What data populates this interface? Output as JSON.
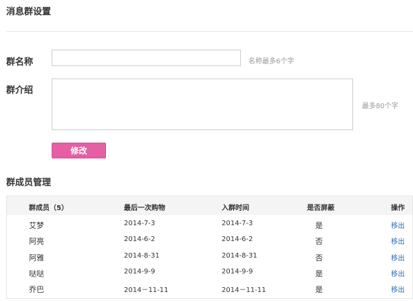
{
  "page_title": "消息群设置",
  "form": {
    "name_label": "群名称",
    "name_value": "",
    "name_hint": "名称最多6个字",
    "intro_label": "群介绍",
    "intro_value": "",
    "intro_hint": "最多80个字",
    "submit_label": "修改"
  },
  "members": {
    "section_title": "群成员管理",
    "columns": [
      "群成员（5）",
      "最后一次购物",
      "入群时间",
      "是否屏蔽",
      "操作"
    ],
    "rows": [
      {
        "name": "艾梦",
        "last_purchase": "2014-7-3",
        "join_time": "2014-7-3",
        "muted": "是",
        "action": "移出"
      },
      {
        "name": "阿亮",
        "last_purchase": "2014-6-2",
        "join_time": "2014-6-2",
        "muted": "否",
        "action": "移出"
      },
      {
        "name": "阿雅",
        "last_purchase": "2014-8-31",
        "join_time": "2014-8-31",
        "muted": "否",
        "action": "移出"
      },
      {
        "name": "哒哒",
        "last_purchase": "2014-9-9",
        "join_time": "2014-9-9",
        "muted": "是",
        "action": "移出"
      },
      {
        "name": "乔巴",
        "last_purchase": "2014－11-11",
        "join_time": "2014－11-11",
        "muted": "是",
        "action": "移出"
      }
    ]
  },
  "colors": {
    "accent": "#e65ea3",
    "link": "#2c6db5",
    "hint": "#999999"
  }
}
